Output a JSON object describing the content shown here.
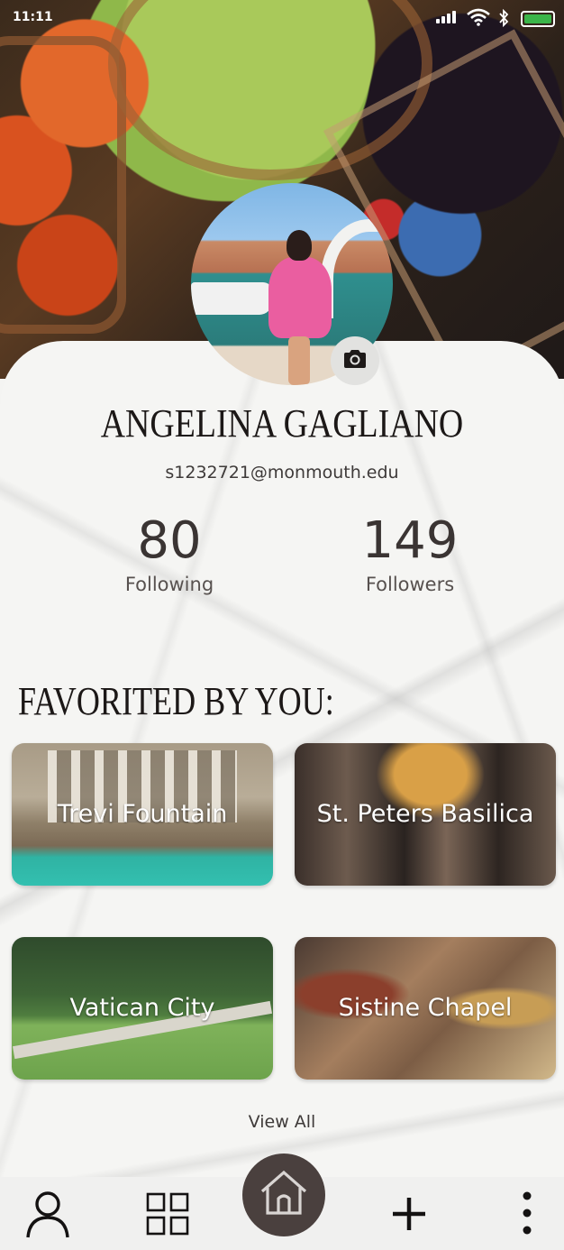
{
  "status_bar": {
    "time": "11:11"
  },
  "profile": {
    "name": "ANGELINA GAGLIANO",
    "email": "s1232721@monmouth.edu",
    "following": {
      "count": "80",
      "label": "Following"
    },
    "followers": {
      "count": "149",
      "label": "Followers"
    }
  },
  "favorites": {
    "title": "FAVORITED BY YOU:",
    "items": [
      {
        "label": "Trevi Fountain"
      },
      {
        "label": "St. Peters Basilica"
      },
      {
        "label": "Vatican City"
      },
      {
        "label": "Sistine Chapel"
      }
    ],
    "view_all": "View All"
  },
  "nav": {
    "items": [
      "profile-icon",
      "grid-icon",
      "home-icon",
      "plus-icon",
      "more-vertical-icon"
    ]
  },
  "colors": {
    "home_button": "#4a403e",
    "battery": "#3bb54a",
    "text_dark": "#1c1817"
  }
}
